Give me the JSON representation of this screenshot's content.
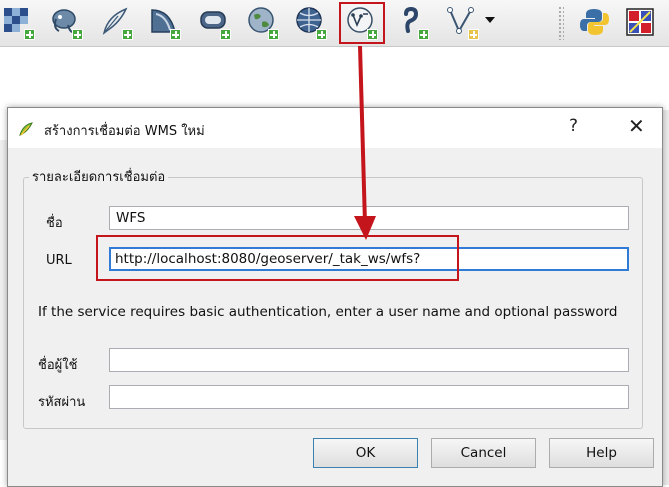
{
  "toolbar": {
    "buttons": [
      {
        "icon": "add-raster-layer-icon"
      },
      {
        "icon": "add-postgis-layer-icon"
      },
      {
        "icon": "add-spatialite-layer-icon"
      },
      {
        "icon": "add-mssql-layer-icon"
      },
      {
        "icon": "add-oracle-layer-icon"
      },
      {
        "icon": "add-wms-layer-icon"
      },
      {
        "icon": "add-wcs-layer-icon"
      },
      {
        "icon": "add-wfs-layer-icon"
      },
      {
        "icon": "add-delimited-text-layer-icon"
      },
      {
        "icon": "new-shapefile-layer-icon"
      },
      {
        "icon": "python-console-icon"
      },
      {
        "icon": "plugin-icon"
      }
    ],
    "highlighted_button": "add-wfs-layer-icon"
  },
  "dialog": {
    "title": "สร้างการเชื่อมต่อ WMS ใหม่",
    "help_glyph": "?",
    "close_glyph": "✕",
    "group_title": "รายละเอียดการเชื่อมต่อ",
    "name_label": "ชื่อ",
    "name_value": "WFS",
    "url_label": "URL",
    "url_value": "http://localhost:8080/geoserver/_tak_ws/wfs?",
    "auth_note": "If the service requires basic authentication, enter a user name and optional password",
    "username_label": "ชื่อผู้ใช้",
    "username_value": "",
    "password_label": "รหัสผ่าน",
    "password_value": "",
    "ok_label": "OK",
    "cancel_label": "Cancel",
    "help_label": "Help"
  },
  "colors": {
    "highlight_red": "#c3151b",
    "focus_blue": "#2f7bd6",
    "dialog_bg": "#f0f0f0"
  }
}
